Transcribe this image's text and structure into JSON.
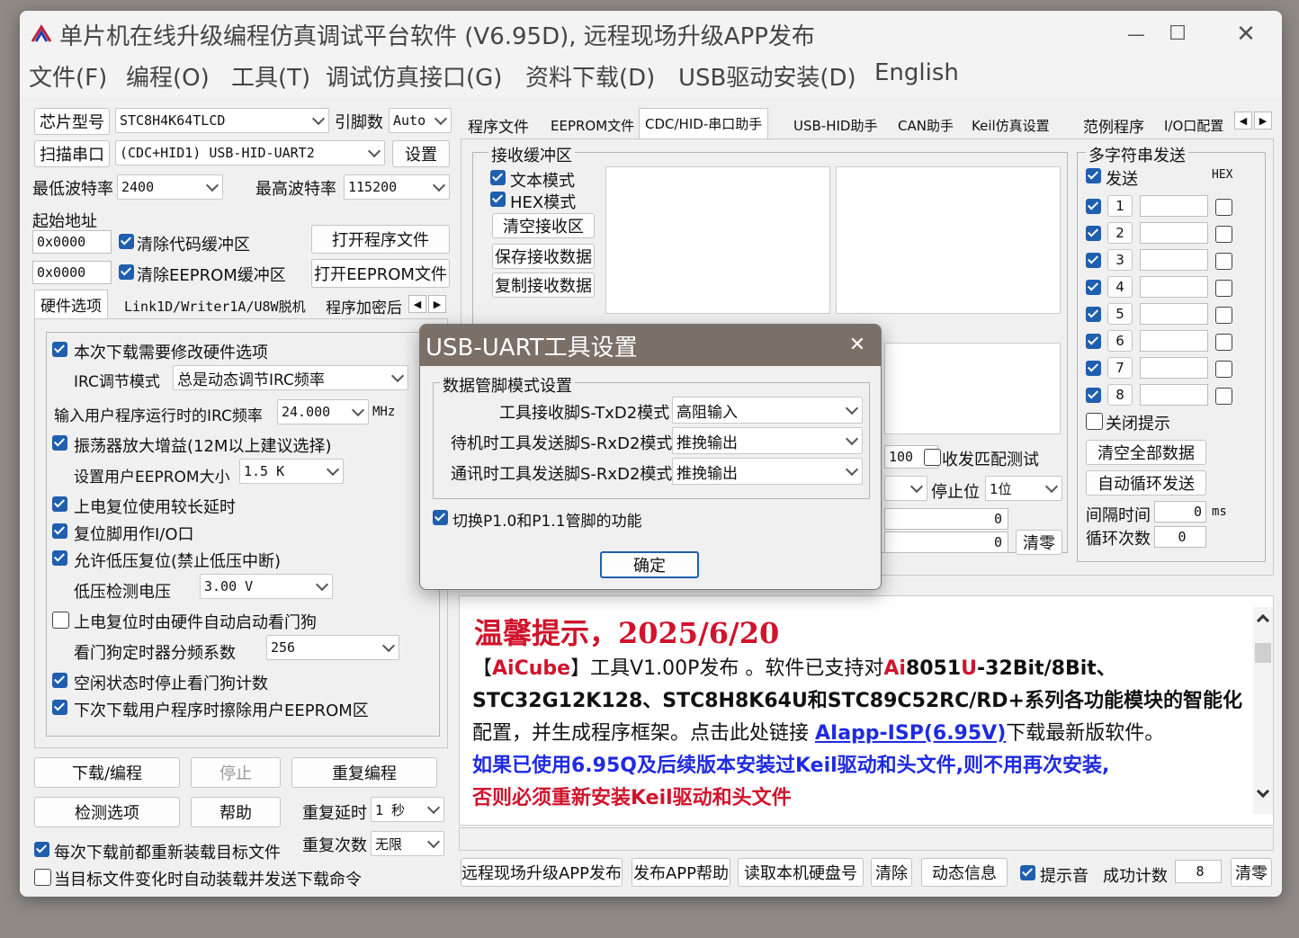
{
  "window": {
    "title": "单片机在线升级编程仿真调试平台软件 (V6.95D), 远程现场升级APP发布",
    "minimize": "—",
    "maximize": "☐",
    "close": "✕"
  },
  "menu": [
    "文件(F)",
    "编程(O)",
    "工具(T)",
    "调试仿真接口(G)",
    "资料下载(D)",
    "USB驱动安装(D)",
    "English"
  ],
  "left": {
    "chip_label": "芯片型号",
    "chip_value": "STC8H4K64TLCD",
    "pins_label": "引脚数",
    "pins_value": "Auto",
    "scan_button": "扫描串口",
    "port_value": "(CDC+HID1) USB-HID-UART2",
    "settings_button": "设置",
    "min_baud_label": "最低波特率",
    "min_baud_value": "2400",
    "max_baud_label": "最高波特率",
    "max_baud_value": "115200",
    "start_addr_label": "起始地址",
    "addr1": "0x0000",
    "clear_code": "清除代码缓冲区",
    "open_program": "打开程序文件",
    "addr2": "0x0000",
    "clear_eeprom": "清除EEPROM缓冲区",
    "open_eeprom": "打开EEPROM文件",
    "tabs": [
      "硬件选项",
      "Link1D/Writer1A/U8W脱机",
      "程序加密后"
    ],
    "hw": {
      "modify_hw": "本次下载需要修改硬件选项",
      "irc_mode_label": "IRC调节模式",
      "irc_mode_value": "总是动态调节IRC频率",
      "irc_freq_label": "输入用户程序运行时的IRC频率",
      "irc_freq_value": "24.000",
      "irc_freq_unit": "MHz",
      "osc_gain": "振荡器放大增益(12M以上建议选择)",
      "eeprom_size_label": "设置用户EEPROM大小",
      "eeprom_size_value": "1.5 K",
      "power_reset_delay": "上电复位使用较长延时",
      "reset_pin_io": "复位脚用作I/O口",
      "lvd_reset": "允许低压复位(禁止低压中断)",
      "lvd_voltage_label": "低压检测电压",
      "lvd_voltage_value": "3.00 V",
      "wdt_auto": "上电复位时由硬件自动启动看门狗",
      "wdt_div_label": "看门狗定时器分频系数",
      "wdt_div_value": "256",
      "idle_stop_wdt": "空闲状态时停止看门狗计数",
      "erase_eeprom": "下次下载用户程序时擦除用户EEPROM区"
    },
    "download_button": "下载/编程",
    "stop_button": "停止",
    "reprogram_button": "重复编程",
    "check_button": "检测选项",
    "help_button": "帮助",
    "repeat_delay_label": "重复延时",
    "repeat_delay_value": "1 秒",
    "repeat_count_label": "重复次数",
    "repeat_count_value": "无限",
    "reload_before": "每次下载前都重新装载目标文件",
    "auto_send": "当目标文件变化时自动装载并发送下载命令"
  },
  "right": {
    "tabs": [
      "程序文件",
      "EEPROM文件",
      "CDC/HID-串口助手",
      "USB-HID助手",
      "CAN助手",
      "Keil仿真设置",
      "范例程序",
      "I/O口配置"
    ],
    "receive_group": "接收缓冲区",
    "text_mode": "文本模式",
    "hex_mode": "HEX模式",
    "clear_receive": "清空接收区",
    "save_receive": "保存接收数据",
    "copy_receive": "复制接收数据",
    "multi_send_group": "多字符串发送",
    "send_label": "发送",
    "hex_label": "HEX",
    "send_rows": [
      "1",
      "2",
      "3",
      "4",
      "5",
      "6",
      "7",
      "8"
    ],
    "close_tip": "关闭提示",
    "clear_all": "清空全部数据",
    "auto_loop": "自动循环发送",
    "interval_label": "间隔时间",
    "interval_value": "0",
    "interval_unit": "ms",
    "loop_count_label": "循环次数",
    "loop_count_value": "0",
    "value_100": "100",
    "match_test": "收发匹配测试",
    "stop_bits_label": "停止位",
    "stop_bits_value": "1位",
    "count_rx": "0",
    "count_tx": "0",
    "clear_counts": "清零",
    "tip_title": "温馨提示，2025/6/20",
    "tip_line1_prefix": "【",
    "tip_line1_aicube": "AiCube",
    "tip_line1_mid": "】工具V1.00P发布 。软件已支持对",
    "tip_line1_ai": "Ai",
    "tip_line1_8051": "8051",
    "tip_line1_u": "U",
    "tip_line1_end": "-32Bit/8Bit、",
    "tip_line2": "STC32G12K128、STC8H8K64U和STC89C52RC/RD+系列各功能模块的智能化",
    "tip_line3_prefix": "配置，并生成程序框架。点击此处链接 ",
    "tip_link": "AIapp-ISP(6.95V)",
    "tip_line3_suffix": "下载最新版软件。",
    "tip_blue": "如果已使用6.95Q及后续版本安装过Keil驱动和头文件,则不用再次安装,",
    "tip_red": "否则必须重新安装Keil驱动和头文件"
  },
  "bottom": {
    "remote_publish": "远程现场升级APP发布",
    "publish_help": "发布APP帮助",
    "read_disk": "读取本机硬盘号",
    "clear": "清除",
    "dynamic_info": "动态信息",
    "prompt_sound": "提示音",
    "success_label": "成功计数",
    "success_value": "8",
    "reset_count": "清零"
  },
  "dialog": {
    "title": "USB-UART工具设置",
    "close": "✕",
    "group": "数据管脚模式设置",
    "row1_label": "工具接收脚S-TxD2模式",
    "row1_value": "高阻输入",
    "row2_label": "待机时工具发送脚S-RxD2模式",
    "row2_value": "推挽输出",
    "row3_label": "通讯时工具发送脚S-RxD2模式",
    "row3_value": "推挽输出",
    "switch_pins": "切换P1.0和P1.1管脚的功能",
    "ok": "确定"
  },
  "colors": {
    "accent": "#1f5fae",
    "tip_red": "#d0142c",
    "tip_blue": "#1f2be0",
    "dialog_title": "#7a7068"
  }
}
